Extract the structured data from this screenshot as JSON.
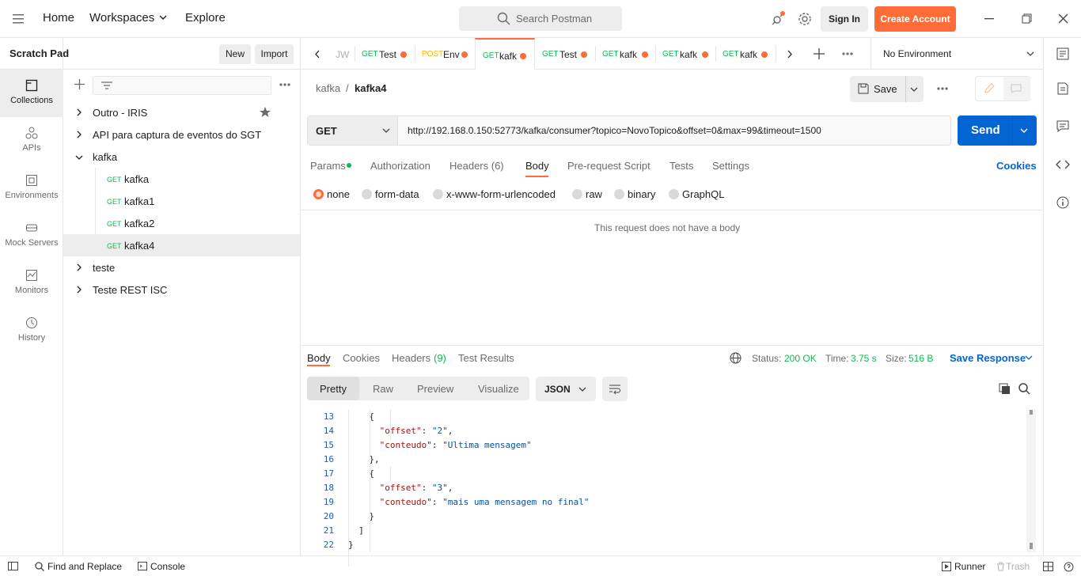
{
  "top": {
    "nav": [
      "Home",
      "Workspaces",
      "Explore"
    ],
    "search_placeholder": "Search Postman",
    "sign_in": "Sign In",
    "create_account": "Create Account"
  },
  "sidebar": {
    "title": "Scratch Pad",
    "new_label": "New",
    "import_label": "Import",
    "rail": [
      "Collections",
      "APIs",
      "Environments",
      "Mock Servers",
      "Monitors",
      "History"
    ],
    "tree": [
      {
        "label": "Outro - IRIS",
        "type": "folder",
        "open": false
      },
      {
        "label": "API para captura de eventos do SGT",
        "type": "folder",
        "open": false
      },
      {
        "label": "kafka",
        "type": "folder",
        "open": true
      },
      {
        "label": "kafka",
        "type": "request",
        "method": "GET"
      },
      {
        "label": "kafka1",
        "type": "request",
        "method": "GET"
      },
      {
        "label": "kafka2",
        "type": "request",
        "method": "GET"
      },
      {
        "label": "kafka4",
        "type": "request",
        "method": "GET"
      },
      {
        "label": "teste",
        "type": "folder",
        "open": false
      },
      {
        "label": "Teste REST ISC",
        "type": "folder",
        "open": false
      }
    ]
  },
  "tabs": [
    {
      "method": "",
      "name": "JW"
    },
    {
      "method": "GET",
      "name": "Test"
    },
    {
      "method": "POST",
      "name": "Env"
    },
    {
      "method": "GET",
      "name": "kafk"
    },
    {
      "method": "GET",
      "name": "Test"
    },
    {
      "method": "GET",
      "name": "kafk"
    },
    {
      "method": "GET",
      "name": "kafk"
    },
    {
      "method": "GET",
      "name": "kafk"
    }
  ],
  "environment": "No Environment",
  "request": {
    "breadcrumb_parent": "kafka",
    "breadcrumb_sep": "/",
    "breadcrumb_name": "kafka4",
    "save_label": "Save",
    "method": "GET",
    "url": "http://192.168.0.150:52773/kafka/consumer?topico=NovoTopico&offset=0&max=99&timeout=1500",
    "send_label": "Send",
    "subtabs": [
      "Params",
      "Authorization",
      "Headers (6)",
      "Body",
      "Pre-request Script",
      "Tests",
      "Settings"
    ],
    "cookies_label": "Cookies",
    "body_types": [
      "none",
      "form-data",
      "x-www-form-urlencoded",
      "raw",
      "binary",
      "GraphQL"
    ],
    "no_body": "This request does not have a body"
  },
  "response": {
    "tabs": [
      "Body",
      "Cookies",
      "Headers",
      "(9)",
      "Test Results"
    ],
    "status_label": "Status:",
    "status_value": "200 OK",
    "time_label": "Time:",
    "time_value": "3.75 s",
    "size_label": "Size:",
    "size_value": "516 B",
    "save_response": "Save Response",
    "views": [
      "Pretty",
      "Raw",
      "Preview",
      "Visualize"
    ],
    "format": "JSON",
    "code_lines": [
      {
        "n": "13",
        "indent": 4,
        "parts": [
          [
            "p",
            "{"
          ]
        ]
      },
      {
        "n": "14",
        "indent": 6,
        "parts": [
          [
            "k",
            "\"offset\""
          ],
          [
            "p",
            ": "
          ],
          [
            "s",
            "\"2\""
          ],
          [
            "p",
            ","
          ]
        ]
      },
      {
        "n": "15",
        "indent": 6,
        "parts": [
          [
            "k",
            "\"conteudo\""
          ],
          [
            "p",
            ": "
          ],
          [
            "s",
            "\"Ultima mensagem\""
          ]
        ]
      },
      {
        "n": "16",
        "indent": 4,
        "parts": [
          [
            "p",
            "},"
          ]
        ]
      },
      {
        "n": "17",
        "indent": 4,
        "parts": [
          [
            "p",
            "{"
          ]
        ]
      },
      {
        "n": "18",
        "indent": 6,
        "parts": [
          [
            "k",
            "\"offset\""
          ],
          [
            "p",
            ": "
          ],
          [
            "s",
            "\"3\""
          ],
          [
            "p",
            ","
          ]
        ]
      },
      {
        "n": "19",
        "indent": 6,
        "parts": [
          [
            "k",
            "\"conteudo\""
          ],
          [
            "p",
            ": "
          ],
          [
            "s",
            "\"mais uma mensagem no final\""
          ]
        ]
      },
      {
        "n": "20",
        "indent": 4,
        "parts": [
          [
            "p",
            "}"
          ]
        ]
      },
      {
        "n": "21",
        "indent": 2,
        "parts": [
          [
            "p",
            "]"
          ]
        ]
      },
      {
        "n": "22",
        "indent": 0,
        "parts": [
          [
            "p",
            "}"
          ]
        ]
      }
    ]
  },
  "statusbar": {
    "find_replace": "Find and Replace",
    "console": "Console",
    "runner": "Runner",
    "trash": "Trash"
  },
  "colors": {
    "accent": "#ff6c37",
    "send": "#0265d2",
    "get": "#0cbb52",
    "post": "#ffb400",
    "link": "#0265d2"
  }
}
